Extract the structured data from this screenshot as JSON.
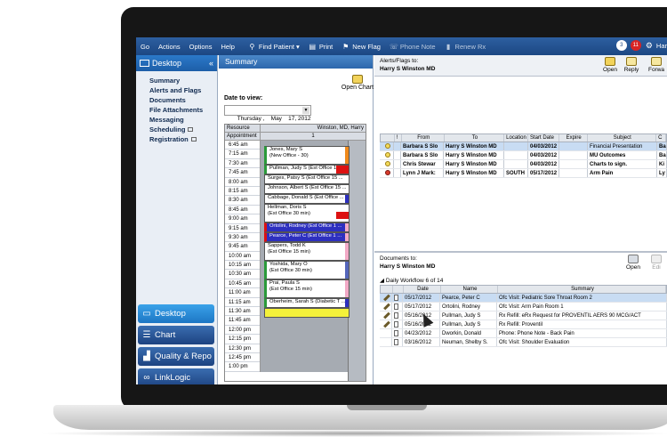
{
  "menubar": {
    "items": [
      "Go",
      "Actions",
      "Options",
      "Help"
    ],
    "find_patient": "Find Patient",
    "print": "Print",
    "new_flag": "New Flag",
    "phone_note": "Phone Note",
    "renew_rx": "Renew Rx",
    "badge_mail": "3",
    "badge_alert": "11",
    "user": "Har"
  },
  "leftnav": {
    "title": "Desktop",
    "items": [
      "Summary",
      "Alerts and Flags",
      "Documents",
      "File Attachments",
      "Messaging",
      "Scheduling",
      "Registration"
    ],
    "buttons": [
      "Desktop",
      "Chart",
      "Quality & Repo",
      "LinkLogic"
    ]
  },
  "summary": {
    "title": "Summary",
    "open_chart": "Open Chart",
    "date_label": "Date to view:",
    "date_value": "Thursday ,    May    17, 2012",
    "resource_label": "Resource",
    "resource_value": "Winston, MD, Harry",
    "appointment_label": "Appointment",
    "appointment_col": "1",
    "times": [
      "6:45 am",
      "7:15 am",
      "7:30 am",
      "7:45 am",
      "8:00 am",
      "8:15 am",
      "8:30 am",
      "8:45 am",
      "9:00 am",
      "9:15 am",
      "9:30 am",
      "9:45 am",
      "10:00 am",
      "10:15 am",
      "10:30 am",
      "10:45 am",
      "11:00 am",
      "11:15 am",
      "11:30 am",
      "11:45 am",
      "12:00 pm",
      "12:15 pm",
      "12:30 pm",
      "12:45 pm",
      "1:00 pm"
    ],
    "appointments": [
      {
        "line1": "Jones, Mary S",
        "line2": "(New Office - 30)"
      },
      {
        "line1": "Pullman, Judy S (Est Office 15 ...",
        "line2": ""
      },
      {
        "line1": "Surges, Patsy S (Est Office 15 ...",
        "line2": ""
      },
      {
        "line1": "Johnson, Albert S (Est Office 15 ...",
        "line2": ""
      },
      {
        "line1": "Cabbage, Donald S (Est Office ...",
        "line2": ""
      },
      {
        "line1": "Hellman, Doris S",
        "line2": "(Est Office 30 min)"
      },
      {
        "line1": "Ortolini, Rodney (Est Office 1 ...",
        "line2": ""
      },
      {
        "line1": "Pearce, Peter C (Est Office 1 ...",
        "line2": ""
      },
      {
        "line1": "Sappers, Todd K",
        "line2": "(Est Office 15 min)"
      },
      {
        "line1": "Yoshida, Mary O",
        "line2": "(Est Office 30 min)"
      },
      {
        "line1": "Prai, Paula S",
        "line2": "(Est Office 15 min)"
      },
      {
        "line1": "Oberheim, Sarah S (Diabetic T ...",
        "line2": ""
      }
    ]
  },
  "alerts": {
    "header_line1": "Alerts/Flags to:",
    "header_line2": "Harry S Winston MD",
    "toolbar": [
      "Open",
      "Reply",
      "Forwa"
    ],
    "columns": [
      "!",
      "From",
      "To",
      "Location",
      "Start Date",
      "Expire",
      "Subject",
      "C"
    ],
    "rows": [
      {
        "from": "Barbara S Slo",
        "to": "Harry S Winston MD",
        "location": "",
        "start": "04/03/2012",
        "expire": "",
        "subject": "Financial Presentation",
        "c": "Ba"
      },
      {
        "from": "Barbara S Slo",
        "to": "Harry S Winston MD",
        "location": "",
        "start": "04/03/2012",
        "expire": "",
        "subject": "MU Outcomes",
        "c": "Ba"
      },
      {
        "from": "Chris Stewar",
        "to": "Harry S Winston MD",
        "location": "",
        "start": "04/03/2012",
        "expire": "",
        "subject": "Charts to sign.",
        "c": "Ki"
      },
      {
        "from": "Lynn J Mark:",
        "to": "Harry S Winston MD",
        "location": "SOUTH",
        "start": "05/17/2012",
        "expire": "",
        "subject": "Arm Pain",
        "c": "Ly"
      }
    ]
  },
  "documents": {
    "header_line1": "Documents to:",
    "header_line2": "Harry S Winston MD",
    "toolbar": [
      "Open",
      "Edi"
    ],
    "workflow": "Daily Workflow 6 of 14",
    "columns": [
      "Date",
      "Name",
      "Summary"
    ],
    "rows": [
      {
        "date": "05/17/2012",
        "name": "Pearce, Peter C",
        "summary": "Ofc Visit: Pediatric Sore Throat  Room 2"
      },
      {
        "date": "05/17/2012",
        "name": "Ortolini, Rodney",
        "summary": "Ofc Visit: Arm Pain  Room 1"
      },
      {
        "date": "05/16/2012",
        "name": "Pullman, Judy S",
        "summary": "Rx Refill: eRx Request for PROVENTIL AERS 90 MCG/ACT"
      },
      {
        "date": "05/16/2012",
        "name": "Pullman, Judy S",
        "summary": "Rx Refill: Proventil"
      },
      {
        "date": "04/23/2012",
        "name": "Dworkin, Donald",
        "summary": "Phone: Phone Note - Back Pain"
      },
      {
        "date": "03/16/2012",
        "name": "Neuman, Shelby S.",
        "summary": "Ofc Visit: Shoulder Evaluation"
      }
    ]
  }
}
